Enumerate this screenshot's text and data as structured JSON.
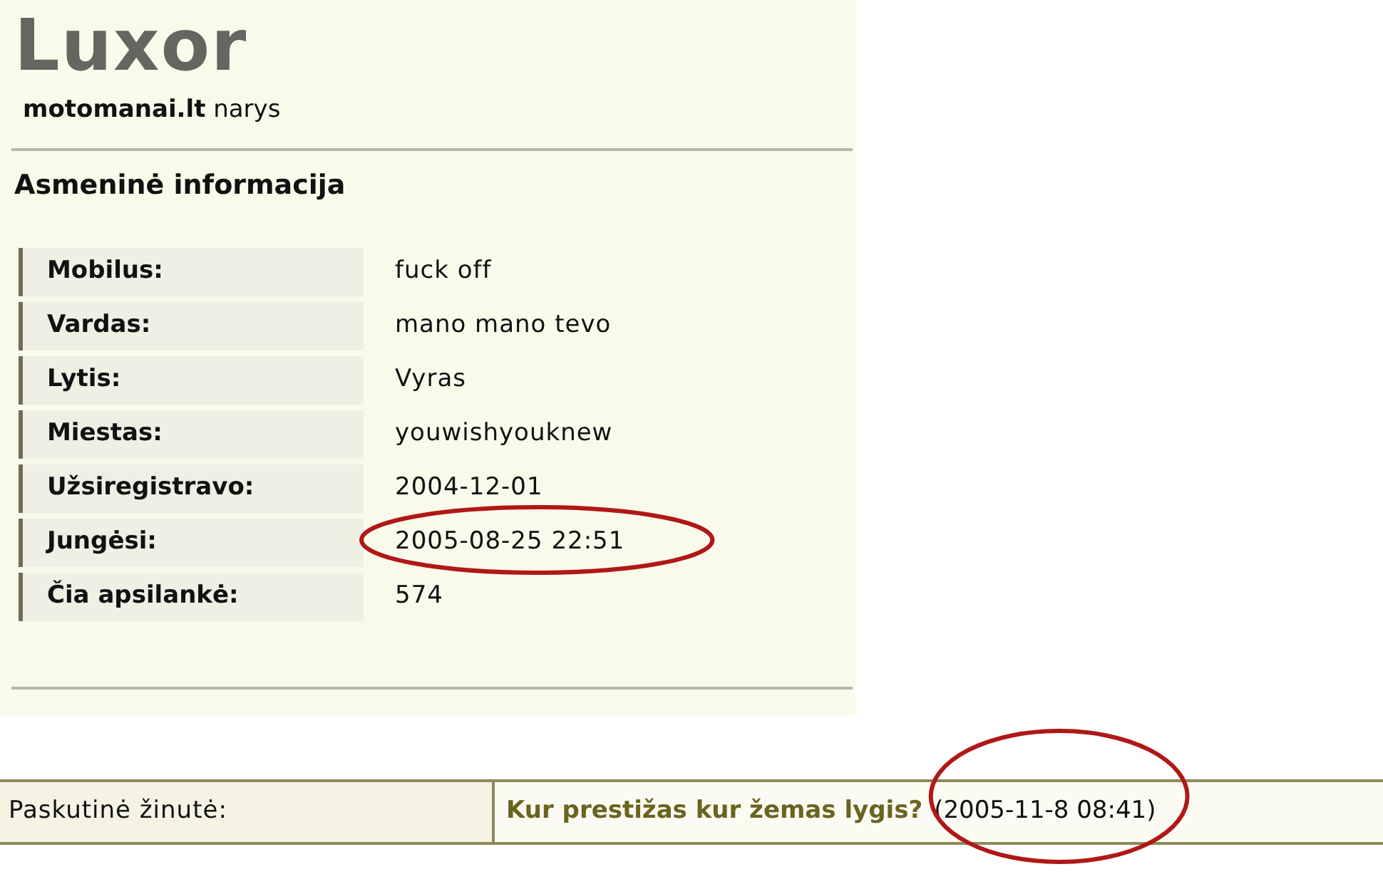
{
  "profile": {
    "name": "Luxor",
    "site": "motomanai.lt",
    "role": "narys"
  },
  "section_title": "Asmeninė informacija",
  "fields": [
    {
      "label": "Mobilus:",
      "value": "fuck off",
      "highlighted": false
    },
    {
      "label": "Vardas:",
      "value": "mano mano tevo",
      "highlighted": false
    },
    {
      "label": "Lytis:",
      "value": "Vyras",
      "highlighted": false
    },
    {
      "label": "Miestas:",
      "value": "youwishyouknew",
      "highlighted": false
    },
    {
      "label": "Užsiregistravo:",
      "value": "2004-12-01",
      "highlighted": false
    },
    {
      "label": "Jungėsi:",
      "value": "2005-08-25 22:51",
      "highlighted": true
    },
    {
      "label": "Čia apsilankė:",
      "value": "574",
      "highlighted": false
    }
  ],
  "last_post": {
    "label": "Paskutinė žinutė:",
    "title": "Kur prestižas kur žemas lygis?",
    "date": "(2005-11-8 08:41)",
    "highlighted": true
  }
}
